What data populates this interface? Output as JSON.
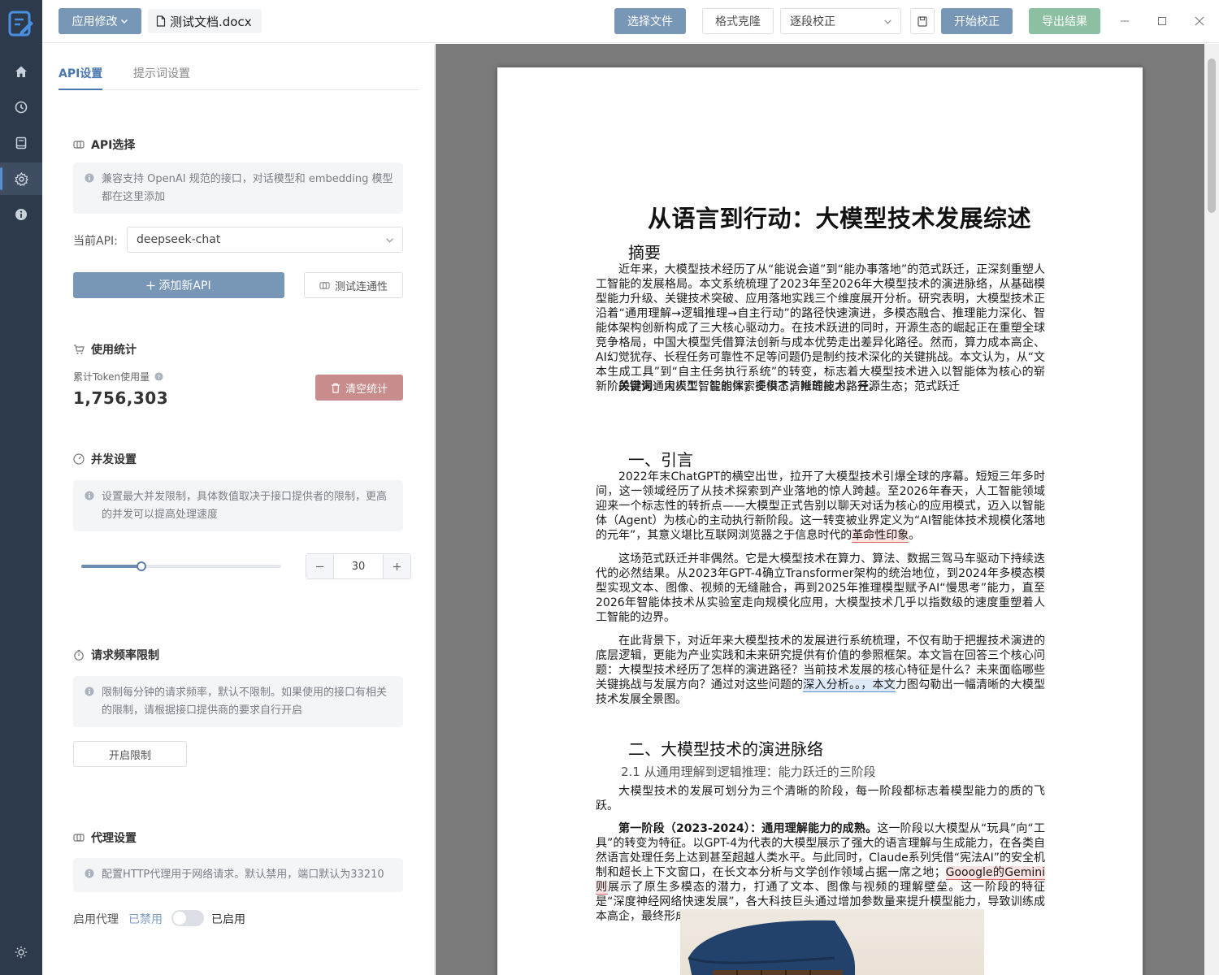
{
  "topbar": {
    "app_menu": "应用修改",
    "file_name": "测试文档.docx",
    "select_file": "选择文件",
    "format_clone": "格式克隆",
    "mode": "逐段校正",
    "start": "开始校正",
    "export": "导出结果"
  },
  "tabs": {
    "api": "API设置",
    "prompt": "提示词设置"
  },
  "api_section": {
    "title": "API选择",
    "info": "兼容支持 OpenAI 规范的接口，对话模型和 embedding 模型都在这里添加",
    "current_label": "当前API:",
    "current_value": "deepseek-chat",
    "add_button": "添加新API",
    "test_button": "测试连通性"
  },
  "usage": {
    "title": "使用统计",
    "token_label": "累计Token使用量",
    "token_value": "1,756,303",
    "clear_button": "清空统计"
  },
  "concurrency": {
    "title": "并发设置",
    "info": "设置最大并发限制，具体数值取决于接口提供者的限制，更高的并发可以提高处理速度",
    "value": "30",
    "slider_fraction": 0.3
  },
  "rate_limit": {
    "title": "请求频率限制",
    "info": "限制每分钟的请求频率，默认不限制。如果使用的接口有相关的限制，请根据接口提供商的要求自行开启",
    "button": "开启限制"
  },
  "proxy": {
    "title": "代理设置",
    "info": "配置HTTP代理用于网络请求。默认禁用，端口默认为33210",
    "enable_label": "启用代理",
    "off_label": "已禁用",
    "on_label": "已启用"
  },
  "doc": {
    "title": "从语言到行动：大模型技术发展综述",
    "abstract_heading": "摘要",
    "abstract": "近年来，大模型技术经历了从“能说会道”到“能办事落地”的范式跃迁，正深刻重塑人工智能的发展格局。本文系统梳理了2023年至2026年大模型技术的演进脉络，从基础模型能力升级、关键技术突破、应用落地实践三个维度展开分析。研究表明，大模型技术正沿着“通用理解→逻辑推理→自主行动”的路径快速演进，多模态融合、推理能力深化、智能体架构创新构成了三大核心驱动力。在技术跃进的同时，开源生态的崛起正在重塑全球竞争格局，中国大模型凭借算法创新与成本优势走出差异化路径。然而，算力成本高企、AI幻觉犹存、长程任务可靠性不足等问题仍是制约技术深化的关键挑战。本文认为，从“文本生成工具”到“自主任务执行系统”的转变，标志着大模型技术进入以智能体为核心的崭新阶段，为通用人工智能的探索提供了清晰的技术路径。",
    "keywords_label": "关键词",
    "keywords": "：大模型；智能体；多模态；推理能力；开源生态；范式跃迁",
    "sec1_heading": "一、引言",
    "p1_pre": "2022年末ChatGPT的横空出世，拉开了大模型技术引爆全球的序幕。短短三年多时间，这一领域经历了从技术探索到产业落地的惊人跨越。至2026年春天，人工智能领域迎来一个标志性的转折点——大模型正式告别以聊天对话为核心的应用模式，迈入以智能体（Agent）为核心的主动执行新阶段。这一转变被业界定义为“AI智能体技术规模化落地的元年”，其意义堪比互联网浏览器之于信息时代的",
    "p1_hl": "革命性印象",
    "p1_post": "。",
    "p2": "这场范式跃迁并非偶然。它是大模型技术在算力、算法、数据三驾马车驱动下持续迭代的必然结果。从2023年GPT-4确立Transformer架构的统治地位，到2024年多模态模型实现文本、图像、视频的无缝融合，再到2025年推理模型赋予AI“慢思考”能力，直至2026年智能体技术从实验室走向规模化应用，大模型技术几乎以指数级的速度重塑着人工智能的边界。",
    "p3_pre": "在此背景下，对近年来大模型技术的发展进行系统梳理，不仅有助于把握技术演进的底层逻辑，更能为产业实践和未来研究提供有价值的参照框架。本文旨在回答三个核心问题：大模型技术经历了怎样的演进路径？当前技术发展的核心特征是什么？未来面临哪些关键挑战与发展方向？通过对这些问题的",
    "p3_hl": "深入分析。。，本文",
    "p3_post": "力图勾勒出一幅清晰的大模型技术发展全景图。",
    "sec2_heading": "二、大模型技术的演进脉络",
    "sub21": "2.1 从通用理解到逻辑推理：能力跃迁的三阶段",
    "p4": "大模型技术的发展可划分为三个清晰的阶段，每一阶段都标志着模型能力的质的飞跃。",
    "p5_bold": "第一阶段（2023-2024）：通用理解能力的成熟。",
    "p5_pre": "这一阶段以大模型从“玩具”向“工具”的转变为特征。以GPT-4为代表的大模型展示了强大的语言理解与生成能力，在各类自然语言处理任务上达到甚至超越人类水平。与此同时，Claude系列凭借“宪法AI”的安全机制和超长上下文窗口，在长文本分析与文学创作领域占据一席之地；",
    "p5_hl": "Gooogle的Gemini 则",
    "p5_post": "展示了原生多模态的潜力，打通了文本、图像与视频的理解壁垒。这一阶段的特征是“深度神经网络快速发展”，各大科技巨头通过增加参数量来提升模型能力，导致训练成本高企，最终形成少数头部企业主导的格局。"
  }
}
